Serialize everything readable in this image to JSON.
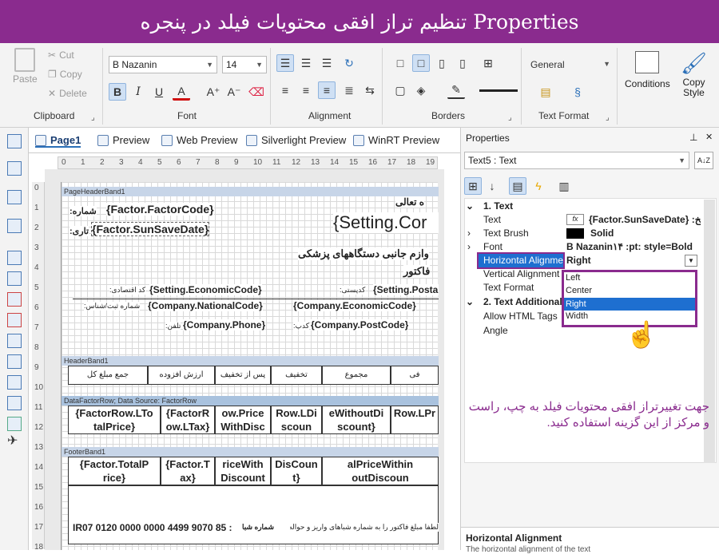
{
  "title": "تنظیم تراز افقی محتویات فیلد در پنجره Properties",
  "ribbon": {
    "clipboard": {
      "paste": "Paste",
      "cut": "Cut",
      "copy": "Copy",
      "delete": "Delete",
      "label": "Clipboard"
    },
    "font": {
      "family": "B Nazanin",
      "size": "14",
      "label": "Font",
      "bold": "B",
      "italic": "I",
      "underline": "U",
      "color": "A"
    },
    "alignment": {
      "label": "Alignment"
    },
    "borders": {
      "label": "Borders"
    },
    "text_format": {
      "value": "General",
      "label": "Text Format"
    },
    "conditions": "Conditions",
    "copy_style": "Copy\nStyle"
  },
  "tabs": [
    "Page1",
    "Preview",
    "Web Preview",
    "Silverlight Preview",
    "WinRT Preview"
  ],
  "ruler_h": [
    "0",
    "1",
    "2",
    "3",
    "4",
    "5",
    "6",
    "7",
    "8",
    "9",
    "10",
    "11",
    "12",
    "13",
    "14",
    "15",
    "16",
    "17",
    "18",
    "19"
  ],
  "ruler_v": [
    "0",
    "1",
    "2",
    "3",
    "4",
    "5",
    "6",
    "7",
    "8",
    "9",
    "10",
    "11",
    "12",
    "13",
    "14",
    "15",
    "16",
    "17",
    "18"
  ],
  "report": {
    "page_header_band": "PageHeaderBand1",
    "header_band": "HeaderBand1",
    "data_band": "DataFactorRow; Data Source: FactorRow",
    "footer_band": "FooterBand1",
    "lbl_number": ":شماره",
    "fld_factor_code": "{Factor.FactorCode}",
    "lbl_date": ":تاری",
    "fld_save_date": "{Factor.SunSaveDate}",
    "fld_setting_company": "{Setting.Cor",
    "lbl_besm": "ه تعالی",
    "lbl_supplies": "وازم جانبی دستگاههای پزشکی",
    "lbl_factor": "فاکتور",
    "fld_economic_code": "{Setting.EconomicCode}",
    "lbl_economic_code": ":کد اقتصادی",
    "fld_postal": "{Setting.Posta",
    "lbl_postal": ":کدپستی",
    "fld_national_code": "{Company.NationalCode}",
    "lbl_national_code": ":شماره ثبت/شناس",
    "fld_company_economic": "{Company.EconomicCode}",
    "fld_phone": "{Company.Phone}",
    "lbl_phone": ":تلفن",
    "fld_company_postal": "{Company.PostCode}",
    "lbl_company_postal": ":کدپ",
    "headers": [
      "جمع مبلغ کل",
      "ارزش افزوده",
      "پس از تخفیف",
      "تخفیف",
      "مجموع",
      "فی"
    ],
    "data_cells": [
      "{FactorRow.LTo\ntalPrice}",
      "{FactorR\now.LTax}",
      "ow.Price\nWithDisc",
      "Row.LDi\nscoun",
      "eWithoutDi\nscount}",
      "Row.LPr"
    ],
    "footer_cells": [
      "{Factor.TotalP\nrice}",
      "{Factor.T\nax}",
      "riceWith\nDiscount",
      "DisCoun\nt}",
      "alPriceWithin\noutDiscoun"
    ],
    "sheba_label": "شماره شبا",
    "sheba": "IR07 0120 0000 0000 4499 9070 85 :",
    "note": "لطفا مبلغ فاکتور را به شماره شباهای واریز و حواله آنرا فاکس نمایید."
  },
  "properties": {
    "title": "Properties",
    "pin": "ᵖ",
    "close": "✕",
    "object": "Text5 : Text",
    "sort": "A↓Z",
    "section1": "1. Text",
    "rows": [
      {
        "key": "Text",
        "value": "{Factor.SunSaveDate} :تاریخ",
        "badge": "fx"
      },
      {
        "key": "Text Brush",
        "value": "Solid"
      },
      {
        "key": "Font",
        "value": "B Nazanin۱۴ :pt: style=Bold"
      },
      {
        "key": "Horizontal Alignme",
        "value": "Right"
      },
      {
        "key": "Vertical Alignment",
        "value": ""
      },
      {
        "key": "Text Format",
        "value": ""
      }
    ],
    "section2": "2. Text  Additional",
    "rows2": [
      {
        "key": "Allow HTML Tags"
      },
      {
        "key": "Angle"
      }
    ],
    "dropdown": [
      "Left",
      "Center",
      "Right",
      "Width"
    ],
    "dropdown_selected": "Right",
    "footer_title": "Horizontal Alignment",
    "footer_desc": "The horizontal alignment of the text"
  },
  "annotation": "جهت تغییرتراز افقی محتویات فیلد به چپ، راست و مرکز از این  گزینه استفاده کنید.",
  "colors": {
    "accent": "#8a2b8e",
    "selection": "#1e6fd0"
  }
}
